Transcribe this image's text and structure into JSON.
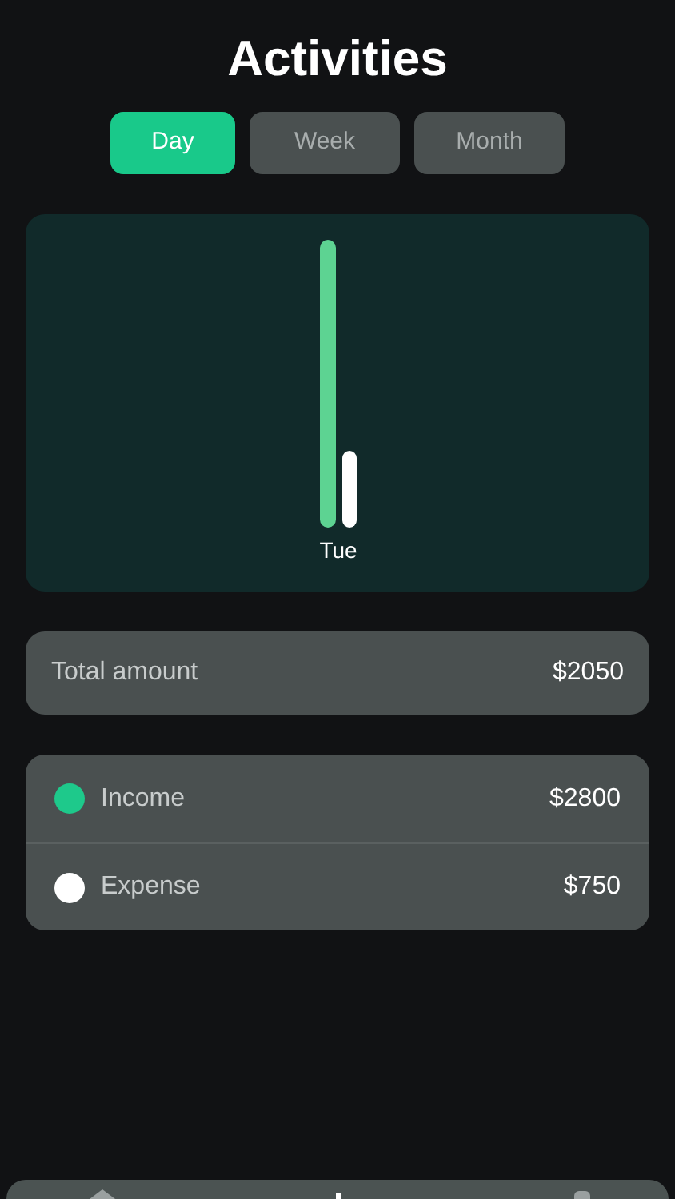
{
  "title": "Activities",
  "tabs": [
    {
      "label": "Day",
      "selected": true
    },
    {
      "label": "Week",
      "selected": false
    },
    {
      "label": "Month",
      "selected": false
    }
  ],
  "chart": {
    "category": "Tue"
  },
  "total": {
    "label": "Total amount",
    "value": "$2050"
  },
  "legend": [
    {
      "label": "Income",
      "value": "$2800",
      "color": "#1ec98b"
    },
    {
      "label": "Expense",
      "value": "$750",
      "color": "#ffffff"
    }
  ]
}
